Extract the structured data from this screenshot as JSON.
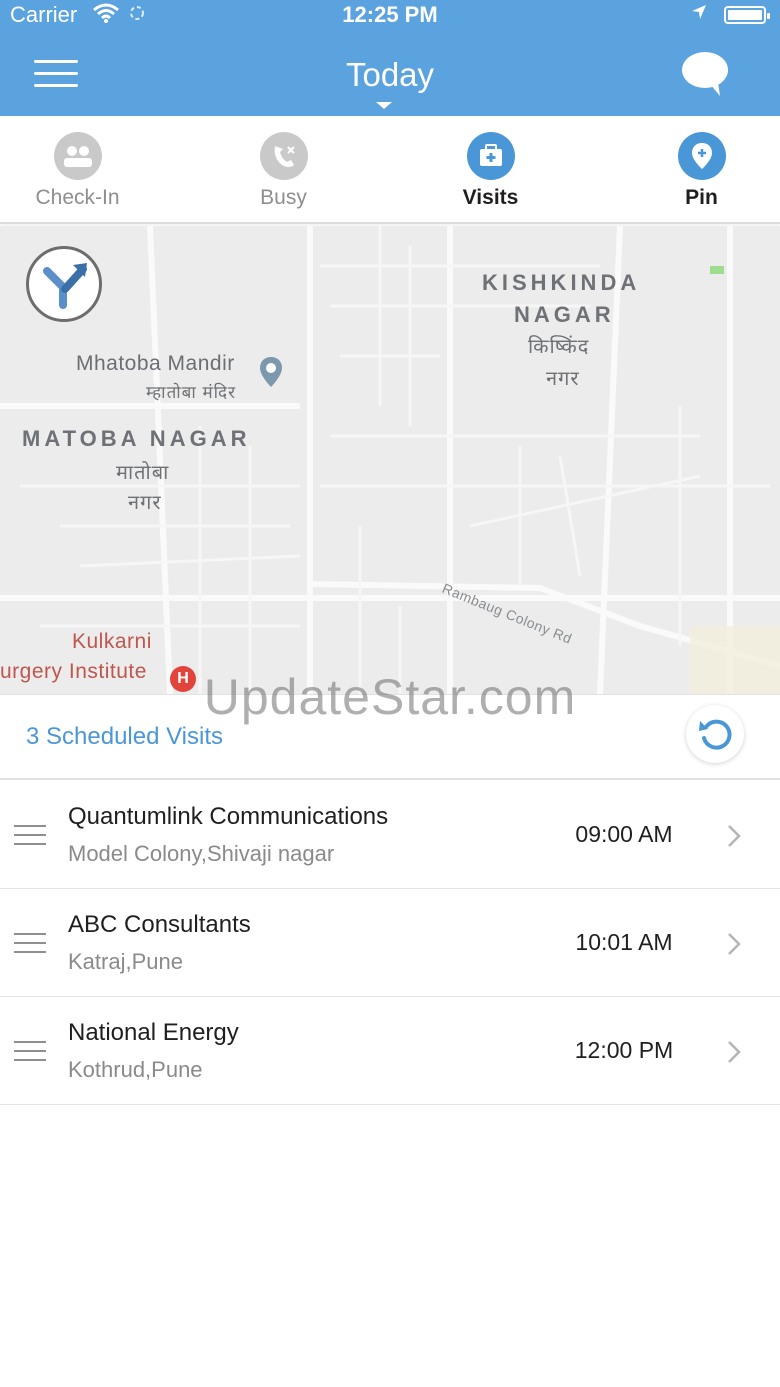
{
  "status_bar": {
    "carrier": "Carrier",
    "time": "12:25 PM",
    "icons": [
      "wifi-icon",
      "sync-icon",
      "location-arrow-icon",
      "battery-icon"
    ]
  },
  "header": {
    "title": "Today",
    "left_icon": "hamburger-menu-icon",
    "right_icon": "chat-bubble-icon",
    "background_color": "#5ba3de"
  },
  "tabs": [
    {
      "label": "Check-In",
      "icon": "check-in-icon",
      "active": false
    },
    {
      "label": "Busy",
      "icon": "busy-phone-icon",
      "active": false
    },
    {
      "label": "Visits",
      "icon": "visits-briefcase-icon",
      "active": true
    },
    {
      "label": "Pin",
      "icon": "pin-icon",
      "active": true
    }
  ],
  "map": {
    "labels": {
      "kishkinda_en_1": "KISHKINDA",
      "kishkinda_en_2": "NAGAR",
      "kishkinda_hi_1": "किष्किंद",
      "kishkinda_hi_2": "नगर",
      "mhatoba_en": "Mhatoba Mandir",
      "mhatoba_hi": "म्हातोबा मंदिर",
      "matoba_en": "MATOBA NAGAR",
      "matoba_hi_1": "मातोबा",
      "matoba_hi_2": "नगर",
      "road": "Rambaug Colony Rd",
      "kulkarni_1": "Kulkarni",
      "kulkarni_2": "urgery Institute",
      "hospital_mark": "H"
    },
    "directions_icon": "directions-icon"
  },
  "watermark": "UpdateStar.com",
  "schedule": {
    "count_label": "3 Scheduled Visits",
    "refresh_icon": "refresh-icon",
    "accent_color": "#4a97d8"
  },
  "visits": [
    {
      "name": "Quantumlink Communications",
      "address": "Model Colony,Shivaji nagar",
      "time": "09:00 AM"
    },
    {
      "name": "ABC Consultants",
      "address": "Katraj,Pune",
      "time": "10:01 AM"
    },
    {
      "name": "National Energy",
      "address": "Kothrud,Pune",
      "time": "12:00 PM"
    }
  ]
}
